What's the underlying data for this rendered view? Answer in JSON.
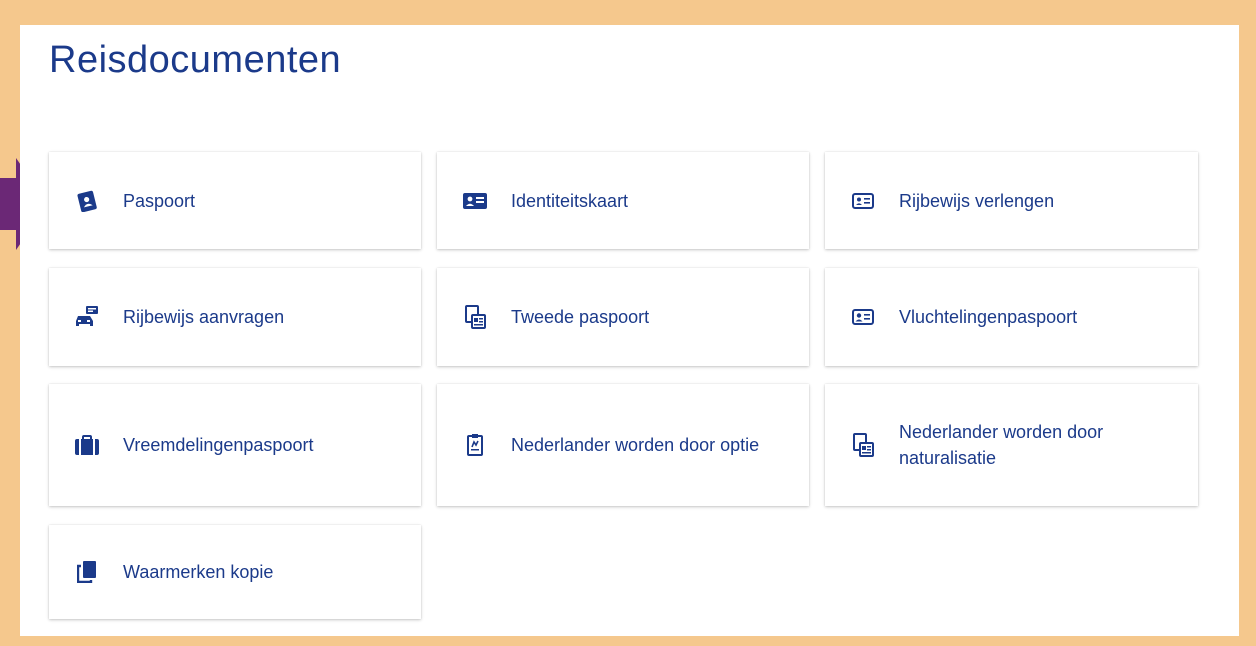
{
  "page": {
    "title": "Reisdocumenten",
    "frame_color": "#f5c88d",
    "accent_color": "#1b3a8a",
    "pointer_color": "#6b2876"
  },
  "tiles": [
    {
      "label": "Paspoort",
      "icon": "passport-icon"
    },
    {
      "label": "Identiteitskaart",
      "icon": "id-card-icon"
    },
    {
      "label": "Rijbewijs verlengen",
      "icon": "license-card-icon"
    },
    {
      "label": "Rijbewijs aanvragen",
      "icon": "car-license-icon"
    },
    {
      "label": "Tweede paspoort",
      "icon": "second-passport-icon"
    },
    {
      "label": "Vluchtelingenpaspoort",
      "icon": "refugee-card-icon"
    },
    {
      "label": "Vreemdelingenpaspoort",
      "icon": "suitcase-icon"
    },
    {
      "label": "Nederlander worden door optie",
      "icon": "document-icon"
    },
    {
      "label": "Nederlander worden door naturalisatie",
      "icon": "naturalisation-icon"
    },
    {
      "label": "Waarmerken kopie",
      "icon": "copy-icon"
    }
  ]
}
